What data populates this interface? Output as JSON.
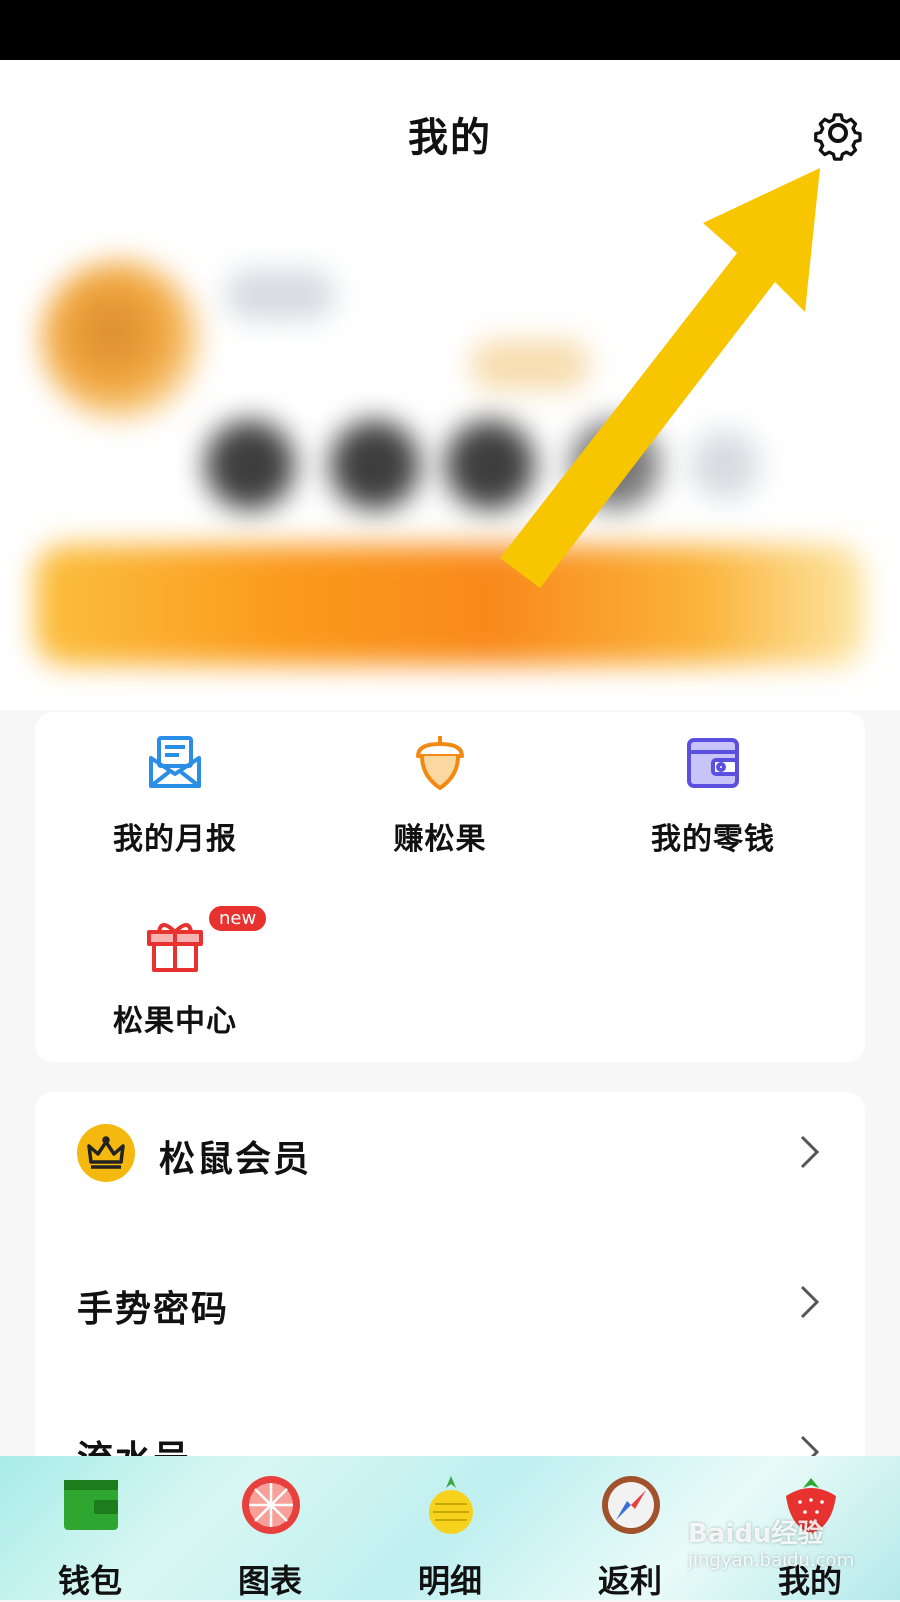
{
  "header": {
    "title": "我的",
    "settings_icon": "gear-icon"
  },
  "quick_actions": [
    {
      "label": "我的月报",
      "icon": "mail-report-icon",
      "color": "#2a8ee6"
    },
    {
      "label": "赚松果",
      "icon": "acorn-icon",
      "color": "#f08a12"
    },
    {
      "label": "我的零钱",
      "icon": "wallet-icon",
      "color": "#5b4fe0"
    },
    {
      "label": "松果中心",
      "icon": "gift-icon",
      "color": "#e8322f",
      "badge": "new"
    }
  ],
  "settings": [
    {
      "label": "松鼠会员",
      "icon": "crown-icon"
    },
    {
      "label": "手势密码"
    },
    {
      "label": "流水号"
    }
  ],
  "tabbar": [
    {
      "label": "钱包",
      "icon": "wallet-tab-icon"
    },
    {
      "label": "图表",
      "icon": "pie-chart-icon"
    },
    {
      "label": "明细",
      "icon": "pineapple-icon"
    },
    {
      "label": "返利",
      "icon": "compass-icon"
    },
    {
      "label": "我的",
      "icon": "strawberry-icon"
    }
  ],
  "watermark": {
    "brand": "Baidu经验",
    "url": "jingyan.baidu.com"
  },
  "colors": {
    "accent_yellow": "#f7c600",
    "vip_gold": "#f5b80f"
  }
}
